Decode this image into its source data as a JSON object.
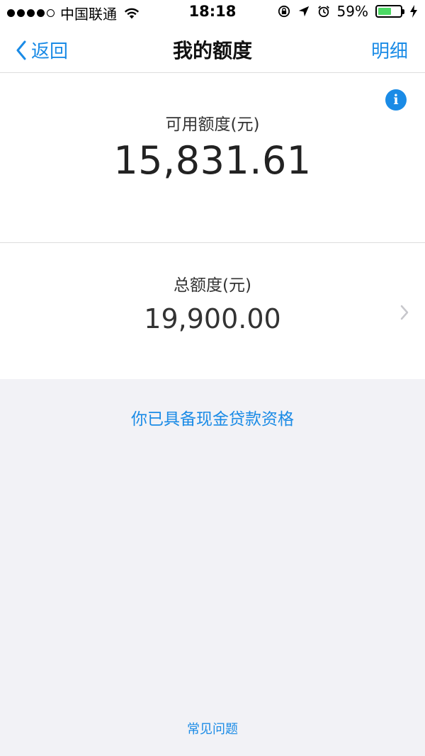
{
  "status_bar": {
    "carrier": "中国联通",
    "time": "18:18",
    "battery_percent": "59%",
    "battery_level": 0.59,
    "signal_bars_filled": 4,
    "signal_bars_total": 5,
    "icons": [
      "wifi-icon",
      "rotation-lock-icon",
      "location-icon",
      "alarm-icon",
      "battery-icon",
      "charging-icon"
    ]
  },
  "nav": {
    "back_label": "返回",
    "title": "我的额度",
    "right_label": "明细"
  },
  "available": {
    "label": "可用额度(元)",
    "amount": "15,831.61",
    "info_glyph": "i"
  },
  "total": {
    "label": "总额度(元)",
    "amount": "19,900.00"
  },
  "loan_eligibility": "你已具备现金贷款资格",
  "faq": "常见问题",
  "colors": {
    "accent": "#1a8be6",
    "background": "#f2f2f6",
    "card": "#ffffff",
    "battery": "#4cd964"
  }
}
